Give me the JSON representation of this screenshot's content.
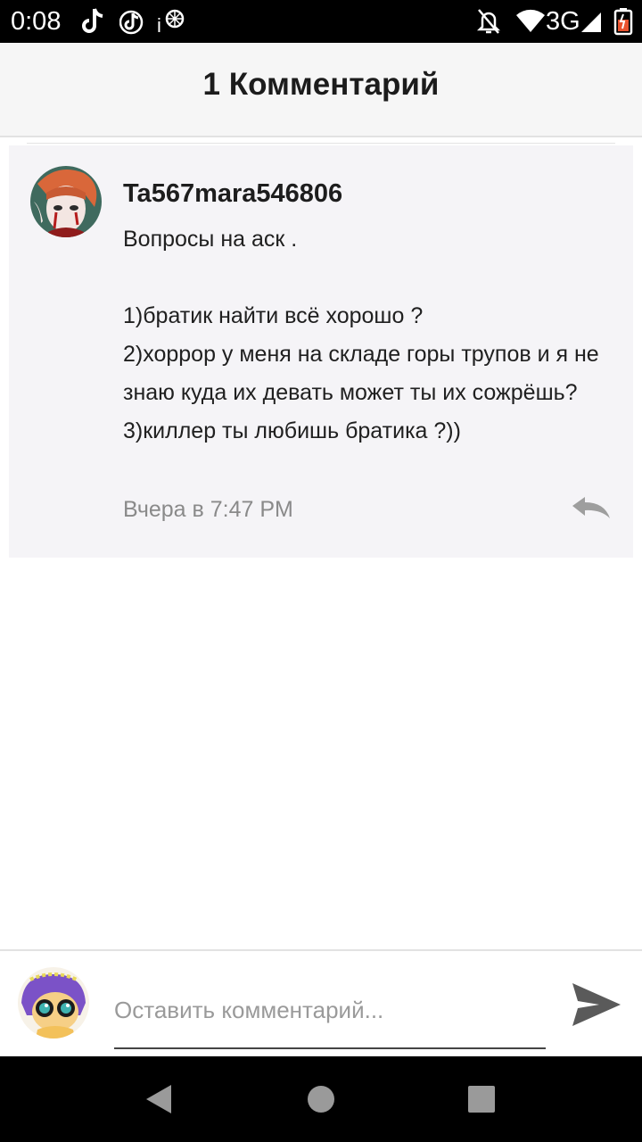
{
  "status_bar": {
    "time": "0:08",
    "network": "3G",
    "icons": [
      "tiktok-icon",
      "tiktok-icon",
      "ip-app-icon",
      "do-not-disturb-icon",
      "wifi-icon",
      "signal-icon",
      "battery-icon"
    ],
    "battery_color": "#e8532f"
  },
  "header": {
    "title": "1 Комментарий"
  },
  "comments": [
    {
      "author": "Ta567mara546806",
      "body": "Вопросы на аск .\n\n1)братик найти всё хорошо ?\n2)хоррор у меня на складе горы трупов и я не знаю куда их девать может ты их сожрёшь?\n3)киллер ты любишь братика ?))",
      "time": "Вчера в 7:47 PM"
    }
  ],
  "input_bar": {
    "placeholder": "Оставить комментарий..."
  },
  "nav_bar": {
    "icons": [
      "back-icon",
      "home-icon",
      "recents-icon"
    ]
  },
  "colors": {
    "card_background": "#f5f4f7",
    "header_background": "#f6f6f6",
    "muted_text": "#8a8a8a"
  }
}
